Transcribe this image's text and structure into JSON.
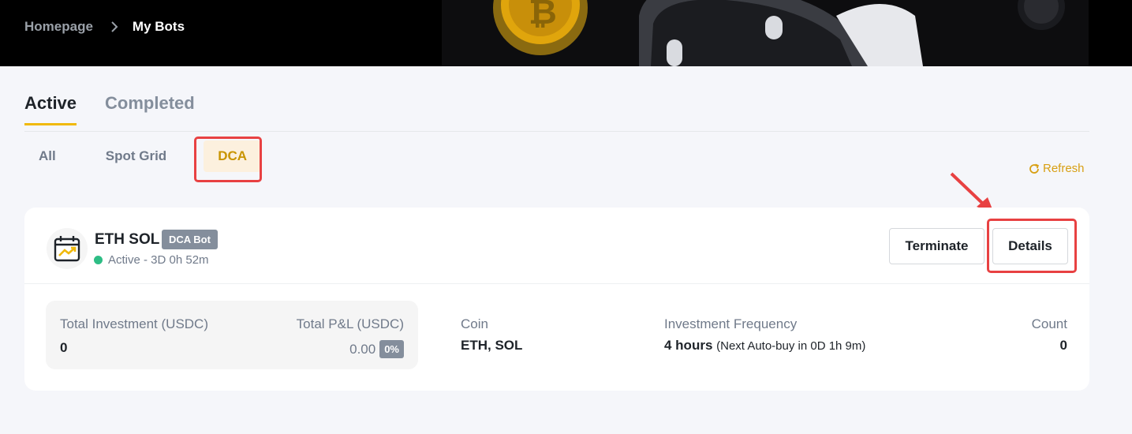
{
  "breadcrumb": {
    "home": "Homepage",
    "current": "My Bots"
  },
  "tabs": [
    {
      "label": "Active",
      "active": true
    },
    {
      "label": "Completed",
      "active": false
    }
  ],
  "filters": [
    {
      "label": "All"
    },
    {
      "label": "Spot Grid"
    },
    {
      "label": "DCA",
      "active": true
    }
  ],
  "refresh_label": "Refresh",
  "bot": {
    "name": "ETH SOL",
    "badge": "DCA Bot",
    "status": "Active - 3D 0h 52m",
    "terminate_label": "Terminate",
    "details_label": "Details",
    "total_investment_label": "Total Investment (USDC)",
    "total_investment_value": "0",
    "total_pnl_label": "Total P&L (USDC)",
    "total_pnl_value": "0.00",
    "total_pnl_percent": "0%",
    "coin_label": "Coin",
    "coin_value": "ETH, SOL",
    "frequency_label": "Investment Frequency",
    "frequency_value": "4 hours",
    "frequency_note": "(Next Auto-buy in 0D 1h 9m)",
    "count_label": "Count",
    "count_value": "0"
  },
  "colors": {
    "accent": "#f0b90b",
    "highlight": "#e84142",
    "status_active": "#2ebd85"
  },
  "icons": [
    "chevron-right-icon",
    "refresh-icon",
    "calendar-chart-icon"
  ]
}
